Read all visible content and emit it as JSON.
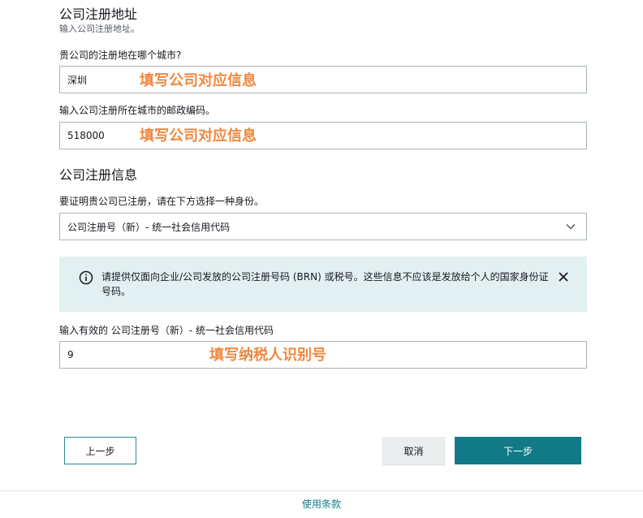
{
  "address_section": {
    "title": "公司注册地址",
    "subtitle": "输入公司注册地址。",
    "city_label": "贵公司的注册地在哪个城市?",
    "city_value": "深圳",
    "postal_label": "输入公司注册所在城市的邮政编码。",
    "postal_value": "518000"
  },
  "registration_section": {
    "title": "公司注册信息",
    "prompt": "要证明贵公司已注册，请在下方选择一种身份。",
    "selected_type": "公司注册号（新）- 统一社会信用代码",
    "info_text": "请提供仅面向企业/公司发放的公司注册号码 (BRN) 或税号。这些信息不应该是发放给个人的国家身份证号码。",
    "id_label": "输入有效的 公司注册号（新）- 统一社会信用代码",
    "id_value": "9"
  },
  "annotations": {
    "city_hint": "填写公司对应信息",
    "postal_hint": "填写公司对应信息",
    "id_hint": "填写纳税人识别号"
  },
  "buttons": {
    "prev": "上一步",
    "cancel": "取消",
    "next": "下一步"
  },
  "footer": {
    "terms_link": "使用条款"
  },
  "icons": {
    "info": "info-circle-icon",
    "close": "close-icon",
    "dropdown": "chevron-down-icon"
  },
  "colors": {
    "primary": "#127a86",
    "annotation": "#f0883e",
    "info_bg": "#e3f0f1"
  }
}
